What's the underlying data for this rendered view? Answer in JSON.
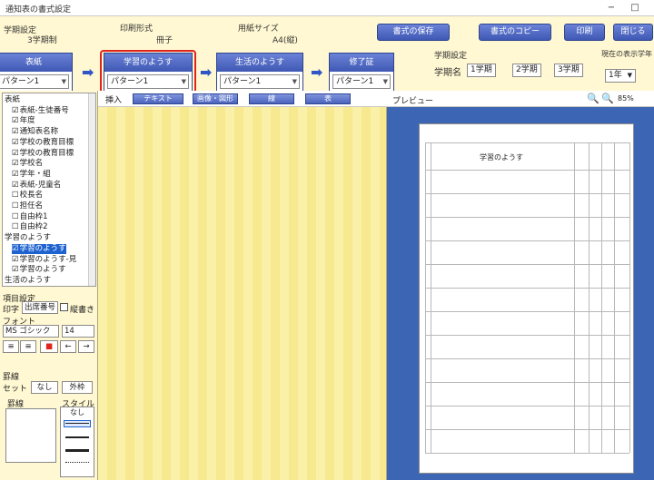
{
  "window": {
    "title": "通知表の書式設定",
    "min_label": "−",
    "max_label": "□"
  },
  "header": {
    "term_setting_label": "学期設定",
    "term_setting_value": "3学期制",
    "print_format_label": "印刷形式",
    "print_format_value": "冊子",
    "paper_size_label": "用紙サイズ",
    "paper_size_value": "A4(縦)",
    "buttons": [
      "書式の保存",
      "書式のコピー",
      "印刷",
      "閉じる"
    ],
    "term_name_section_label": "学期設定",
    "term_name_label": "学期名",
    "terms": [
      "1学期",
      "2学期",
      "3学期"
    ],
    "current_display_label": "現在の表示学年",
    "current_display_value": "1年"
  },
  "steps": [
    {
      "caption": "表紙",
      "value": "パターン1"
    },
    {
      "caption": "学習のようす",
      "value": "パターン1"
    },
    {
      "caption": "生活のようす",
      "value": "パターン1"
    },
    {
      "caption": "修了証",
      "value": "パターン1"
    }
  ],
  "tree": {
    "items": [
      {
        "text": "表紙",
        "level": 0,
        "checked": false,
        "selected": false
      },
      {
        "text": "表紙-生徒番号",
        "level": 1,
        "checked": true,
        "selected": false
      },
      {
        "text": "年度",
        "level": 1,
        "checked": true,
        "selected": false
      },
      {
        "text": "通知表名称",
        "level": 1,
        "checked": true,
        "selected": false
      },
      {
        "text": "学校の教育目標",
        "level": 1,
        "checked": true,
        "selected": false
      },
      {
        "text": "学校の教育目標",
        "level": 1,
        "checked": true,
        "selected": false
      },
      {
        "text": "学校名",
        "level": 1,
        "checked": true,
        "selected": false
      },
      {
        "text": "学年・組",
        "level": 1,
        "checked": true,
        "selected": false
      },
      {
        "text": "表紙-児童名",
        "level": 1,
        "checked": true,
        "selected": false
      },
      {
        "text": "校長名",
        "level": 1,
        "checked": false,
        "selected": false
      },
      {
        "text": "担任名",
        "level": 1,
        "checked": false,
        "selected": false
      },
      {
        "text": "自由枠1",
        "level": 1,
        "checked": false,
        "selected": false
      },
      {
        "text": "自由枠2",
        "level": 1,
        "checked": false,
        "selected": false
      },
      {
        "text": "学習のようす",
        "level": 0,
        "checked": false,
        "selected": false
      },
      {
        "text": "学習のようす",
        "level": 1,
        "checked": true,
        "selected": true
      },
      {
        "text": "学習のようす-見",
        "level": 1,
        "checked": true,
        "selected": false
      },
      {
        "text": "学習のようす",
        "level": 1,
        "checked": true,
        "selected": false
      },
      {
        "text": "生活のようす",
        "level": 0,
        "checked": false,
        "selected": false
      }
    ]
  },
  "left_settings": {
    "section_label": "項目設定",
    "order_label": "印字",
    "order_value": "出席番号",
    "vertical_label": "縦書き",
    "font_label": "フォント",
    "font_value": "MS ゴシック",
    "size_value": "14",
    "border_label": "罫線",
    "set_label": "セット",
    "none_button": "なし",
    "outer_button": "外枠",
    "line_label": "罫線",
    "style_label": "スタイル",
    "style_none": "なし"
  },
  "edit": {
    "insert_label": "挿入",
    "buttons": [
      "テキスト",
      "画像・図形",
      "線",
      "表"
    ]
  },
  "preview": {
    "label": "プレビュー",
    "zoom": "85%",
    "paper_title": "学習のようす"
  }
}
